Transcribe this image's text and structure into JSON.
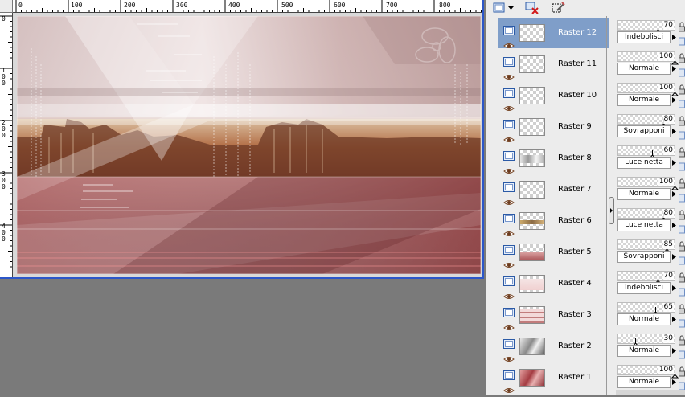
{
  "canvas": {
    "ruler_top_labels": [
      "0",
      "100",
      "200",
      "300",
      "400",
      "500",
      "600",
      "700",
      "800"
    ],
    "ruler_left_labels": [
      "0",
      "100",
      "200",
      "300",
      "400"
    ]
  },
  "colors": {
    "selection_highlight": "#7f9ec9",
    "window_border": "#2c56c9",
    "workspace_background": "#7a7a7a"
  },
  "toolbar": {
    "buttons": [
      {
        "icon": "new-layer-icon"
      },
      {
        "icon": "dropdown-arrow-icon"
      },
      {
        "icon": "delete-layer-icon"
      },
      {
        "icon": "mask-selection-icon"
      }
    ]
  },
  "layers": [
    {
      "name": "Raster 12",
      "opacity": 70,
      "blend": "Indebolisci",
      "selected": true,
      "thumb": "empty"
    },
    {
      "name": "Raster 11",
      "opacity": 100,
      "blend": "Normale",
      "selected": false,
      "thumb": "empty"
    },
    {
      "name": "Raster 10",
      "opacity": 100,
      "blend": "Normale",
      "selected": false,
      "thumb": "empty"
    },
    {
      "name": "Raster 9",
      "opacity": 80,
      "blend": "Sovrapponi",
      "selected": false,
      "thumb": "empty"
    },
    {
      "name": "Raster 8",
      "opacity": 60,
      "blend": "Luce netta",
      "selected": false,
      "thumb": "grey-streak"
    },
    {
      "name": "Raster 7",
      "opacity": 100,
      "blend": "Normale",
      "selected": false,
      "thumb": "empty"
    },
    {
      "name": "Raster 6",
      "opacity": 80,
      "blend": "Luce netta",
      "selected": false,
      "thumb": "city-strip"
    },
    {
      "name": "Raster 5",
      "opacity": 85,
      "blend": "Sovrapponi",
      "selected": false,
      "thumb": "red-lower"
    },
    {
      "name": "Raster 4",
      "opacity": 70,
      "blend": "Indebolisci",
      "selected": false,
      "thumb": "faint-pink"
    },
    {
      "name": "Raster 3",
      "opacity": 65,
      "blend": "Normale",
      "selected": false,
      "thumb": "pink-stripes"
    },
    {
      "name": "Raster 2",
      "opacity": 30,
      "blend": "Normale",
      "selected": false,
      "thumb": "greyscale"
    },
    {
      "name": "Raster 1",
      "opacity": 100,
      "blend": "Normale",
      "selected": false,
      "thumb": "red-full"
    }
  ],
  "icons": {
    "layer_type": "raster-layer-icon",
    "visibility": "eye-icon",
    "lock": "lock-icon",
    "link": "link-icon",
    "blend_dropdown": "dropdown-arrow-icon"
  }
}
